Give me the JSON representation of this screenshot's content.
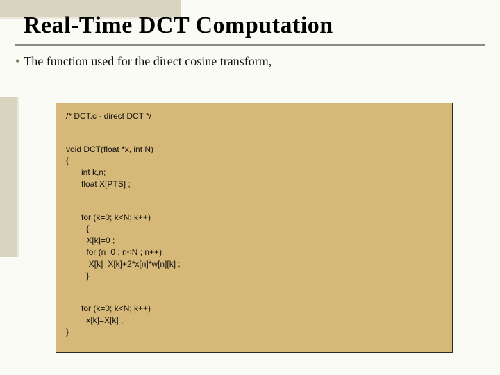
{
  "slide": {
    "title": "Real-Time DCT Computation",
    "bullet": "The function used for the direct cosine transform,"
  },
  "code": {
    "comment": "/* DCT.c - direct DCT */",
    "sig": "void DCT(float *x, int N)",
    "brace_open": "{",
    "decl1": "int k,n;",
    "decl2": "float X[PTS] ;",
    "loop1_for": "for (k=0; k<N; k++)",
    "loop1_brace_open": " {",
    "loop1_init": " X[k]=0 ;",
    "loop1_inner_for": " for (n=0 ; n<N ; n++)",
    "loop1_body": "  X[k]=X[k]+2*x[n]*w[n][k] ;",
    "loop1_brace_close": " }",
    "loop2_for": "for (k=0; k<N; k++)",
    "loop2_body": " x[k]=X[k] ;",
    "brace_close": "}"
  }
}
